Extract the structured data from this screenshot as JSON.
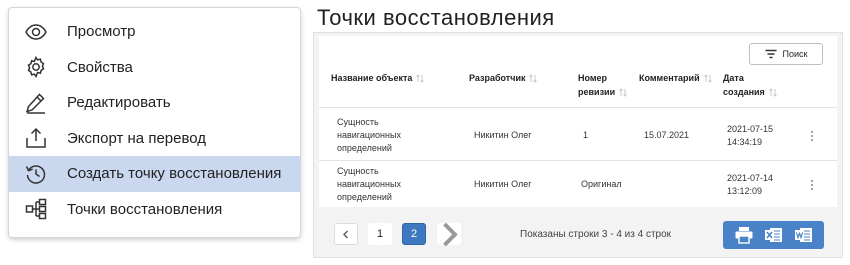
{
  "menu": {
    "items": [
      {
        "label": "Просмотр",
        "icon": "eye-icon"
      },
      {
        "label": "Свойства",
        "icon": "gear-icon"
      },
      {
        "label": "Редактировать",
        "icon": "pencil-icon"
      },
      {
        "label": "Экспорт на перевод",
        "icon": "upload-icon"
      },
      {
        "label": "Создать точку восстановления",
        "icon": "history-icon",
        "active": true
      },
      {
        "label": "Точки восстановления",
        "icon": "hierarchy-icon"
      }
    ]
  },
  "panel": {
    "title": "Точки восстановления",
    "search_label": "Поиск",
    "columns": [
      {
        "line1": "Название объекта",
        "line2": ""
      },
      {
        "line1": "Разработчик",
        "line2": ""
      },
      {
        "line1": "Номер",
        "line2": "ревизии"
      },
      {
        "line1": "Комментарий",
        "line2": ""
      },
      {
        "line1": "Дата",
        "line2": "создания"
      }
    ],
    "rows": [
      {
        "name": [
          "Сущность",
          "навигационных",
          "определений"
        ],
        "developer": "Никитин Олег",
        "revision": "1",
        "comment": "15.07.2021",
        "date": [
          "2021-07-15",
          "14:34:19"
        ]
      },
      {
        "name": [
          "Сущность",
          "навигационных",
          "определений"
        ],
        "developer": "Никитин Олег",
        "revision": "Оригинал",
        "comment": "",
        "date": [
          "2021-07-14",
          "13:12:09"
        ]
      }
    ],
    "pagination": {
      "pages": [
        "1",
        "2"
      ],
      "current": "2",
      "info": "Показаны строки 3 - 4 из 4 строк"
    },
    "export_icons": [
      "printer-icon",
      "excel-icon",
      "word-icon"
    ]
  },
  "colors": {
    "accent": "#3d78c0",
    "active_menu_bg": "#c9d8ef",
    "export_bg": "#4a82c8"
  }
}
